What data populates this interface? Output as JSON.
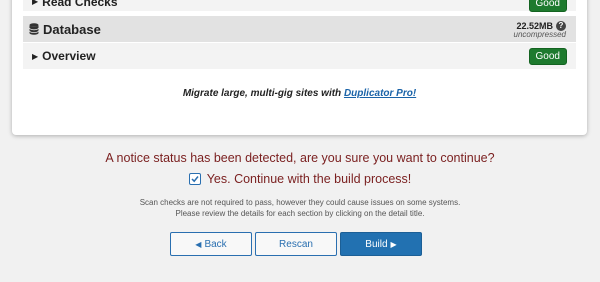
{
  "checks": {
    "read_checks": {
      "label": "Read Checks",
      "status": "Good"
    },
    "database": {
      "title": "Database",
      "size": "22.52MB",
      "size_note": "uncompressed",
      "help_glyph": "?"
    },
    "overview": {
      "label": "Overview",
      "status": "Good"
    }
  },
  "promo": {
    "text": "Migrate large, multi-gig sites with ",
    "link": "Duplicator Pro!"
  },
  "notice": {
    "message": "A notice status has been detected, are you sure you want to continue?"
  },
  "confirm": {
    "checked": true,
    "label": "Yes. Continue with the build process!"
  },
  "help": {
    "line1": "Scan checks are not required to pass, however they could cause issues on some systems.",
    "line2": "Please review the details for each section by clicking on the detail title."
  },
  "buttons": {
    "back": "Back",
    "rescan": "Rescan",
    "build": "Build"
  },
  "icons": {
    "caret": "caret-right-icon",
    "database": "database-icon",
    "help": "question-circle-icon",
    "check": "checkmark-icon",
    "back": "caret-left-icon",
    "build": "caret-right-icon"
  },
  "colors": {
    "good": "#1e7a2e",
    "primary": "#2271b1",
    "notice": "#7a1f1f",
    "link": "#1a63a8"
  }
}
